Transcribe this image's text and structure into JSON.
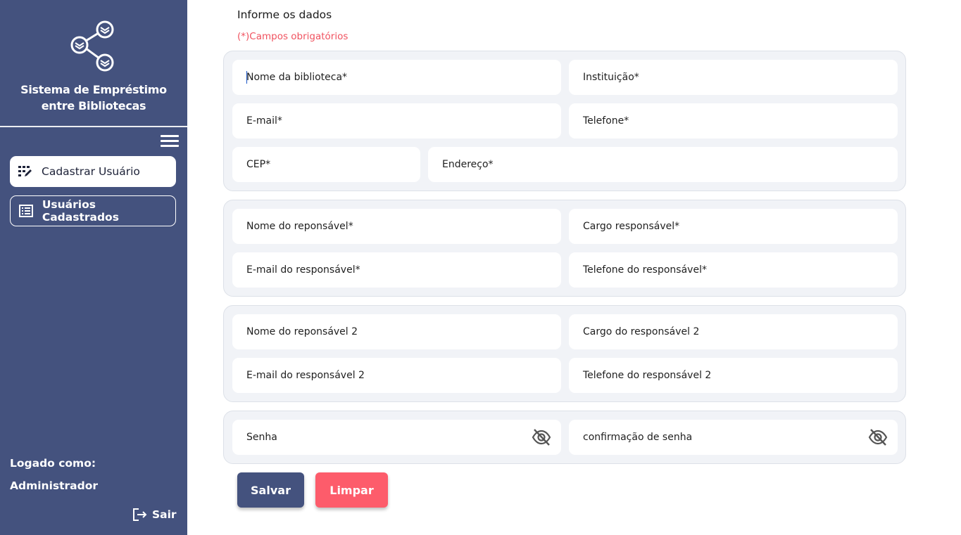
{
  "sidebar": {
    "brand_line1": "Sistema de Empréstimo",
    "brand_line2": "entre Bibliotecas",
    "items": [
      {
        "label": "Cadastrar Usuário",
        "icon": "edit-grid-icon",
        "active": true
      },
      {
        "label": "Usuários Cadastrados",
        "icon": "list-icon",
        "active": false
      }
    ],
    "logged_label": "Logado como:",
    "logged_user": "Administrador",
    "logout_label": "Sair"
  },
  "form": {
    "title": "Informe os dados",
    "required_note": "(*)Campos obrigatórios",
    "library": {
      "name": "Nome da biblioteca*",
      "institution": "Instituição*",
      "email": "E-mail*",
      "phone": "Telefone*",
      "cep": "CEP*",
      "address": "Endereço*"
    },
    "responsible": {
      "name": "Nome do reponsável*",
      "role": "Cargo responsável*",
      "email": "E-mail do responsável*",
      "phone": "Telefone do responsável*"
    },
    "responsible2": {
      "name": "Nome do reponsável 2",
      "role": "Cargo do responsável 2",
      "email": "E-mail do responsável 2",
      "phone": "Telefone do responsável 2"
    },
    "password": {
      "password": "Senha",
      "confirm": "confirmação de senha"
    },
    "save_label": "Salvar",
    "clear_label": "Limpar"
  },
  "colors": {
    "sidebar": "#44527e",
    "danger": "#fd5c6b",
    "required_text": "#f0525f",
    "panel": "#f1f3f7"
  }
}
